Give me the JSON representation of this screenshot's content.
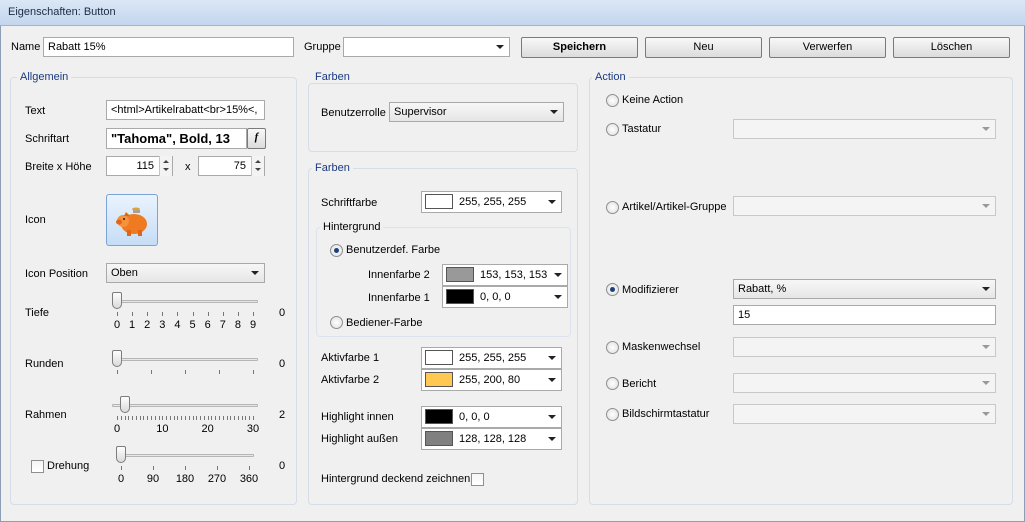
{
  "window": {
    "title": "Eigenschaften: Button"
  },
  "top": {
    "name_label": "Name",
    "name_value": "Rabatt 15%",
    "gruppe_label": "Gruppe",
    "gruppe_value": "",
    "save": "Speichern",
    "new": "Neu",
    "discard": "Verwerfen",
    "delete": "Löschen"
  },
  "allgemein": {
    "title": "Allgemein",
    "text_label": "Text",
    "text_value": "<html>Artikelrabatt<br>15%<,",
    "font_label": "Schriftart",
    "font_value": "\"Tahoma\", Bold, 13",
    "font_button": "f",
    "size_label": "Breite x Höhe",
    "width": "115",
    "x": "x",
    "height": "75",
    "icon_label": "Icon",
    "iconpos_label": "Icon Position",
    "iconpos_value": "Oben",
    "tiefe_label": "Tiefe",
    "tiefe_value": "0",
    "tiefe_fraction": 0,
    "tiefe_ticks": [
      "0",
      "1",
      "2",
      "3",
      "4",
      "5",
      "6",
      "7",
      "8",
      "9"
    ],
    "runden_label": "Runden",
    "runden_value": "0",
    "runden_fraction": 0,
    "rahmen_label": "Rahmen",
    "rahmen_value": "2",
    "rahmen_fraction": 0.0556,
    "rahmen_ticks": [
      "0",
      "10",
      "20",
      "30"
    ],
    "drehung_label": "Drehung",
    "drehung_value": "0",
    "drehung_fraction": 0,
    "drehung_ticks": [
      "0",
      "90",
      "180",
      "270",
      "360"
    ]
  },
  "farben1": {
    "title": "Farben",
    "role_label": "Benutzerrolle",
    "role_value": "Supervisor"
  },
  "farben2": {
    "title": "Farben",
    "schriftfarbe_label": "Schriftfarbe",
    "schriftfarbe_value": "255, 255, 255",
    "schriftfarbe_color": "#ffffff",
    "hintergrund_title": "Hintergrund",
    "benutzerdef_label": "Benutzerdef. Farbe",
    "innen2_label": "Innenfarbe 2",
    "innen2_value": "153, 153, 153",
    "innen2_color": "#999999",
    "innen1_label": "Innenfarbe 1",
    "innen1_value": "0, 0, 0",
    "innen1_color": "#000000",
    "bediener_label": "Bediener-Farbe",
    "aktiv1_label": "Aktivfarbe 1",
    "aktiv1_value": "255, 255, 255",
    "aktiv1_color": "#ffffff",
    "aktiv2_label": "Aktivfarbe 2",
    "aktiv2_value": "255, 200, 80",
    "aktiv2_color": "#ffc850",
    "hl_innen_label": "Highlight innen",
    "hl_innen_value": "0, 0, 0",
    "hl_innen_color": "#000000",
    "hl_aussen_label": "Highlight außen",
    "hl_aussen_value": "128, 128, 128",
    "hl_aussen_color": "#808080",
    "deckend_label": "Hintergrund deckend zeichnen"
  },
  "action": {
    "title": "Action",
    "keine": "Keine Action",
    "tastatur": "Tastatur",
    "artikel": "Artikel/Artikel-Gruppe",
    "modifizierer": "Modifizierer",
    "modifizierer_value": "Rabatt, %",
    "modifizierer_amount": "15",
    "maskenwechsel": "Maskenwechsel",
    "bericht": "Bericht",
    "bildschirm": "Bildschirmtastatur"
  }
}
